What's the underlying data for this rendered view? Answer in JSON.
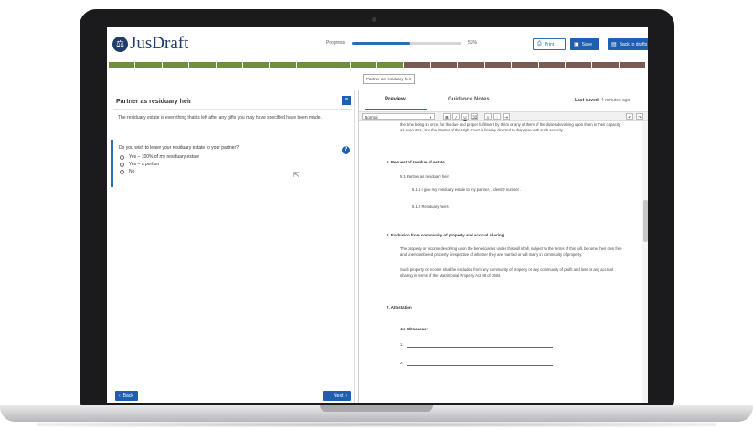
{
  "header": {
    "logo_text": "JusDraft",
    "logo_icon": "scales-icon",
    "progress_label": "Progress",
    "progress_value": 53,
    "progress_text": "53%",
    "print_label": "Print",
    "save_label": "Save",
    "back_label": "Back to drafts"
  },
  "sections": {
    "completed_color": "#6f8f3c",
    "pending_color": "#7a5a52",
    "completed_count": 11,
    "total_count": 20,
    "tooltip": "Partner as residuary heir"
  },
  "left": {
    "title": "Partner as residuary heir",
    "intro": "The residuary estate is everything that is left after any gifts you may have specified have been made.",
    "question": "Do you wish to leave your residuary estate to your partner?",
    "options": [
      "Yes – 100% of my residuary estate",
      "Yes – a portion",
      "No"
    ],
    "back_label": "Back",
    "next_label": "Next"
  },
  "right": {
    "tabs": [
      "Preview",
      "Guidance Notes"
    ],
    "last_saved_label": "Last saved:",
    "last_saved_value": "4 minutes ago",
    "style_value": "Normal"
  },
  "document": {
    "top_para": "the time being in force, for the due and proper fulfilment by them or any of them of the duties devolving upon them in their capacity as executors, and the Master of the High Court is hereby directed to dispense with such security.",
    "s5_heading": "5.    Bequest of residue of estate",
    "s5_1": "5.1    Partner as residuary heir",
    "s5_1_1": "5.1.1    I give  my residuary estate to my partner, , identity number .",
    "s5_1_2": "5.1.2    Residuary heirs",
    "s6_heading": "6.    Exclusion from community of property and accrual sharing",
    "s6_p1": "The property or income devolving upon the beneficiaries under this will shall, subject to the terms of this will, become their own free and unencumbered property irrespective of whether they are married or will marry in community of property.",
    "s6_p2": "Such property or income shall be excluded from any community of property or any community of profit and loss or any accrual sharing in terms of the Matrimonial Property Act 88 of 1984.",
    "s7_heading": "7.    Attestation",
    "witnesses": "As Witnesses:",
    "w1": "1.",
    "w2": "2."
  }
}
